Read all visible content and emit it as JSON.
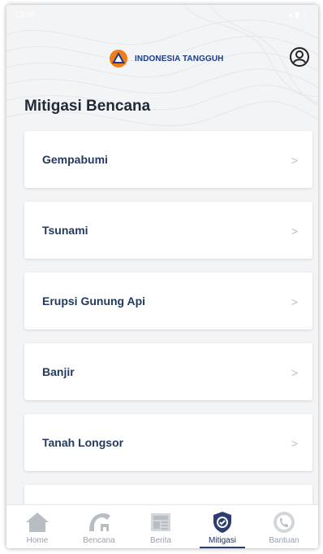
{
  "status_bar": {
    "time": "13:06"
  },
  "header": {
    "brand_text": "INDONESIA TANGGUH"
  },
  "page": {
    "title": "Mitigasi Bencana"
  },
  "items": [
    {
      "label": "Gempabumi"
    },
    {
      "label": "Tsunami"
    },
    {
      "label": "Erupsi Gunung Api"
    },
    {
      "label": "Banjir"
    },
    {
      "label": "Tanah Longsor"
    },
    {
      "label": ""
    }
  ],
  "chevron": ">",
  "nav": [
    {
      "label": "Home",
      "icon": "home-icon"
    },
    {
      "label": "Bencana",
      "icon": "disaster-icon"
    },
    {
      "label": "Berita",
      "icon": "news-icon"
    },
    {
      "label": "Mitigasi",
      "icon": "mitigation-shield-icon",
      "active": true
    },
    {
      "label": "Bantuan",
      "icon": "phone-help-icon"
    }
  ],
  "colors": {
    "brand": "#1a3b8f",
    "logo_orange": "#f07d1a",
    "active_nav": "#2c3e70"
  }
}
